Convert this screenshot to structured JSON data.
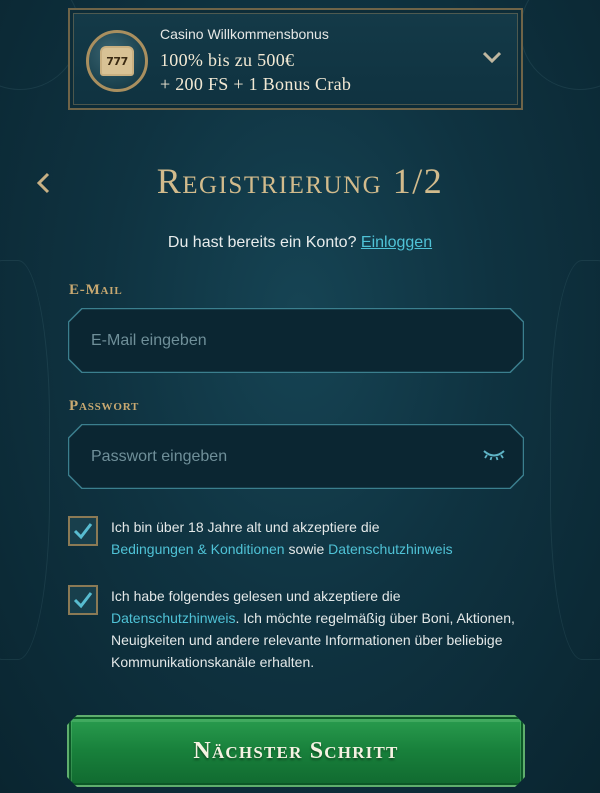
{
  "bonus": {
    "subtitle": "Casino Willkommensbonus",
    "line1": "100% bis zu 500€",
    "line2": "+ 200 FS + 1 Bonus Crab",
    "badge_icon": "slot-machine-icon",
    "badge_text": "777",
    "chevron_icon": "chevron-down-icon"
  },
  "header": {
    "back_icon": "chevron-left-icon",
    "title": "Registrierung 1/2"
  },
  "login": {
    "prompt": "Du hast bereits ein Konto?",
    "link": "Einloggen"
  },
  "form": {
    "email": {
      "label": "E-Mail",
      "placeholder": "E-Mail eingeben",
      "value": ""
    },
    "password": {
      "label": "Passwort",
      "placeholder": "Passwort eingeben",
      "value": "",
      "toggle_icon": "eye-closed-icon"
    },
    "consent_age": {
      "checked": true,
      "text_before": "Ich bin über 18 Jahre alt und akzeptiere die",
      "link_terms": "Bedingungen & Konditionen",
      "text_mid": " sowie ",
      "link_privacy": "Datenschutzhinweis"
    },
    "consent_marketing": {
      "checked": true,
      "text_before": "Ich habe folgendes gelesen und akzeptiere die",
      "link_privacy": "Datenschutzhinweis",
      "text_after": ". Ich möchte regelmäßig über Boni, Aktionen, Neuigkeiten und andere relevante Informationen über beliebige Kommunikationskanäle erhalten."
    }
  },
  "actions": {
    "next_label": "Nächster Schritt"
  },
  "colors": {
    "background": "#0f3341",
    "gold": "#d2bb8c",
    "link": "#4fc2d6",
    "button_green": "#18803b"
  }
}
